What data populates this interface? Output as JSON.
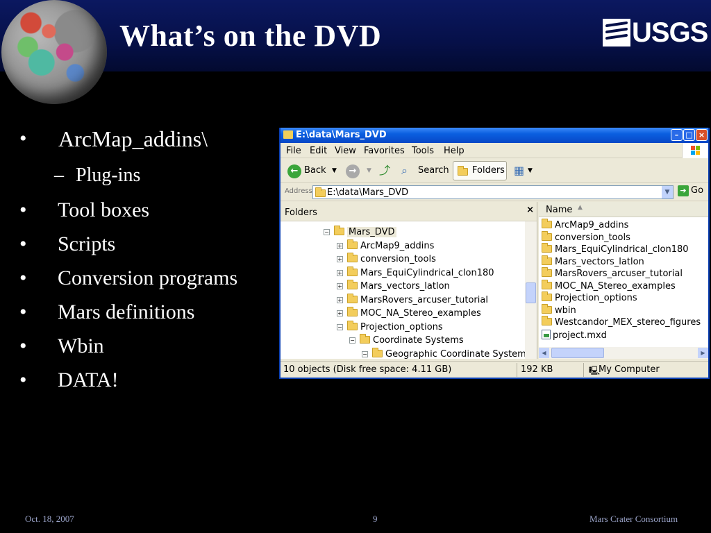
{
  "slide": {
    "title": "What’s on the DVD",
    "logo_text": "USGS"
  },
  "bullets": [
    {
      "marker": "•",
      "text": "ArcMap_addins\\"
    },
    {
      "marker": "–",
      "text": "Plug-ins"
    },
    {
      "marker": "•",
      "text": "Tool boxes"
    },
    {
      "marker": "•",
      "text": "Scripts"
    },
    {
      "marker": "•",
      "text": "Conversion programs"
    },
    {
      "marker": "•",
      "text": "Mars definitions"
    },
    {
      "marker": "•",
      "text": "Wbin"
    },
    {
      "marker": "•",
      "text": "DATA!"
    }
  ],
  "explorer": {
    "title": "E:\\data\\Mars_DVD",
    "menu": [
      "File",
      "Edit",
      "View",
      "Favorites",
      "Tools",
      "Help"
    ],
    "toolbar": {
      "back": "Back",
      "search": "Search",
      "folders": "Folders"
    },
    "address": {
      "label": "Address",
      "value": "E:\\data\\Mars_DVD",
      "go": "Go"
    },
    "folders_pane": {
      "title": "Folders",
      "close": "×",
      "tree": [
        {
          "label": "Mars_DVD",
          "expander": "⊟"
        },
        {
          "label": "ArcMap9_addins",
          "expander": "⊞"
        },
        {
          "label": "conversion_tools",
          "expander": "⊞"
        },
        {
          "label": "Mars_EquiCylindrical_clon180",
          "expander": "⊞"
        },
        {
          "label": "Mars_vectors_latlon",
          "expander": "⊞"
        },
        {
          "label": "MarsRovers_arcuser_tutorial",
          "expander": "⊞"
        },
        {
          "label": "MOC_NA_Stereo_examples",
          "expander": "⊞"
        },
        {
          "label": "Projection_options",
          "expander": "⊟"
        },
        {
          "label": "Coordinate Systems",
          "expander": "⊟"
        },
        {
          "label": "Geographic Coordinate Systems",
          "expander": "⊟"
        }
      ]
    },
    "list_pane": {
      "column": "Name",
      "items": [
        "ArcMap9_addins",
        "conversion_tools",
        "Mars_EquiCylindrical_clon180",
        "Mars_vectors_latlon",
        "MarsRovers_arcuser_tutorial",
        "MOC_NA_Stereo_examples",
        "Projection_options",
        "wbin",
        "Westcandor_MEX_stereo_figures"
      ],
      "file": "project.mxd"
    },
    "status": {
      "objects": "10 objects (Disk free space: 4.11 GB)",
      "size": "192 KB",
      "location": "My Computer"
    }
  },
  "footer": {
    "date": "Oct. 18, 2007",
    "page": "9",
    "org": "Mars Crater Consortium"
  },
  "colors": {
    "header_band": "#061048",
    "xp_titlebar": "#0a5fe0",
    "background": "#000000"
  }
}
